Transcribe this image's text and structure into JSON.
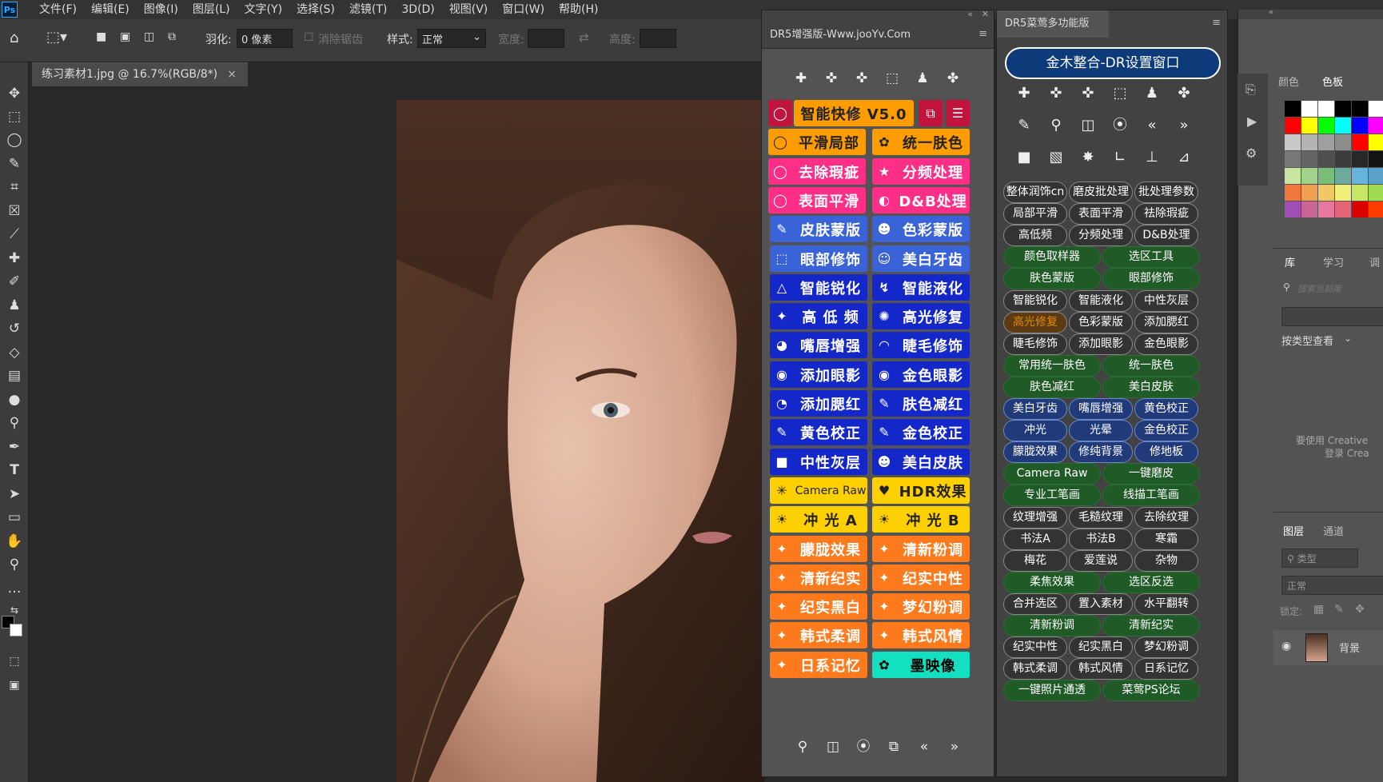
{
  "menubar": {
    "logo": "Ps",
    "items": [
      "文件(F)",
      "编辑(E)",
      "图像(I)",
      "图层(L)",
      "文字(Y)",
      "选择(S)",
      "滤镜(T)",
      "3D(D)",
      "视图(V)",
      "窗口(W)",
      "帮助(H)"
    ]
  },
  "options": {
    "feather_label": "羽化:",
    "feather_value": "0 像素",
    "antialias_label": "消除锯齿",
    "style_label": "样式:",
    "style_value": "正常",
    "width_label": "宽度:",
    "height_label": "高度:"
  },
  "doc_tab": {
    "title": "练习素材1.jpg @ 16.7%(RGB/8*)",
    "close": "×"
  },
  "panel1": {
    "title": "DR5增强版-Www.jooYv.Com",
    "buttons": [
      {
        "left": {
          "icon": "◯",
          "label": "智能快修 V5.0",
          "color": "#ff9d00",
          "text": "#222"
        }
      },
      {
        "left": {
          "icon": "◯",
          "label": "平滑局部",
          "color": "#ff9d00",
          "text": "#222"
        },
        "right": {
          "icon": "✿",
          "label": "统一肤色",
          "color": "#ff9d00",
          "text": "#222"
        }
      },
      {
        "left": {
          "icon": "◯",
          "label": "去除瑕疵",
          "color": "#ff2e87",
          "text": "#fff"
        },
        "right": {
          "icon": "★",
          "label": "分频处理",
          "color": "#ff2e87",
          "text": "#fff"
        }
      },
      {
        "left": {
          "icon": "◯",
          "label": "表面平滑",
          "color": "#ff2e87",
          "text": "#fff"
        },
        "right": {
          "icon": "◐",
          "label": "D&B处理",
          "color": "#ff2e87",
          "text": "#fff"
        }
      },
      {
        "left": {
          "icon": "✎",
          "label": "皮肤蒙版",
          "color": "#3b63d8",
          "text": "#fff"
        },
        "right": {
          "icon": "☻",
          "label": "色彩蒙版",
          "color": "#3b63d8",
          "text": "#fff"
        }
      },
      {
        "left": {
          "icon": "⬚",
          "label": "眼部修饰",
          "color": "#3b63d8",
          "text": "#fff"
        },
        "right": {
          "icon": "☺",
          "label": "美白牙齿",
          "color": "#3b63d8",
          "text": "#fff"
        }
      },
      {
        "left": {
          "icon": "△",
          "label": "智能锐化",
          "color": "#1427c9",
          "text": "#fff"
        },
        "right": {
          "icon": "↯",
          "label": "智能液化",
          "color": "#1427c9",
          "text": "#fff"
        }
      },
      {
        "left": {
          "icon": "✦",
          "label": "高 低 频",
          "color": "#1427c9",
          "text": "#fff"
        },
        "right": {
          "icon": "✺",
          "label": "高光修复",
          "color": "#1427c9",
          "text": "#fff"
        }
      },
      {
        "left": {
          "icon": "◕",
          "label": "嘴唇增强",
          "color": "#1427c9",
          "text": "#fff"
        },
        "right": {
          "icon": "◠",
          "label": "睫毛修饰",
          "color": "#1427c9",
          "text": "#fff"
        }
      },
      {
        "left": {
          "icon": "◉",
          "label": "添加眼影",
          "color": "#1427c9",
          "text": "#fff"
        },
        "right": {
          "icon": "◉",
          "label": "金色眼影",
          "color": "#1427c9",
          "text": "#fff"
        }
      },
      {
        "left": {
          "icon": "◔",
          "label": "添加腮红",
          "color": "#1427c9",
          "text": "#fff"
        },
        "right": {
          "icon": "✎",
          "label": "肤色减红",
          "color": "#1427c9",
          "text": "#fff"
        }
      },
      {
        "left": {
          "icon": "✎",
          "label": "黄色校正",
          "color": "#1427c9",
          "text": "#fff"
        },
        "right": {
          "icon": "✎",
          "label": "金色校正",
          "color": "#1427c9",
          "text": "#fff"
        }
      },
      {
        "left": {
          "icon": "■",
          "label": "中性灰层",
          "color": "#1427c9",
          "text": "#fff"
        },
        "right": {
          "icon": "☻",
          "label": "美白皮肤",
          "color": "#1427c9",
          "text": "#fff"
        }
      },
      {
        "left": {
          "icon": "✳",
          "label": "Camera Raw",
          "color": "#ffd000",
          "text": "#222"
        },
        "right": {
          "icon": "♥",
          "label": "HDR效果",
          "color": "#ffd000",
          "text": "#222"
        }
      },
      {
        "left": {
          "icon": "☀",
          "label": "冲 光 A",
          "color": "#ffd000",
          "text": "#222"
        },
        "right": {
          "icon": "☀",
          "label": "冲 光 B",
          "color": "#ffd000",
          "text": "#222"
        }
      },
      {
        "left": {
          "icon": "✦",
          "label": "朦胧效果",
          "color": "#ff7a1c",
          "text": "#fff"
        },
        "right": {
          "icon": "✦",
          "label": "清新粉调",
          "color": "#ff7a1c",
          "text": "#fff"
        }
      },
      {
        "left": {
          "icon": "✦",
          "label": "清新纪实",
          "color": "#ff7a1c",
          "text": "#fff"
        },
        "right": {
          "icon": "✦",
          "label": "纪实中性",
          "color": "#ff7a1c",
          "text": "#fff"
        }
      },
      {
        "left": {
          "icon": "✦",
          "label": "纪实黑白",
          "color": "#ff7a1c",
          "text": "#fff"
        },
        "right": {
          "icon": "✦",
          "label": "梦幻粉调",
          "color": "#ff7a1c",
          "text": "#fff"
        }
      },
      {
        "left": {
          "icon": "✦",
          "label": "韩式柔调",
          "color": "#ff7a1c",
          "text": "#fff"
        },
        "right": {
          "icon": "✦",
          "label": "韩式风情",
          "color": "#ff7a1c",
          "text": "#fff"
        }
      },
      {
        "left": {
          "icon": "✦",
          "label": "日系记忆",
          "color": "#ff7a1c",
          "text": "#fff"
        },
        "right": {
          "icon": "✿",
          "label": "墨映像",
          "color": "#12e0c0",
          "text": "#000"
        }
      }
    ]
  },
  "panel2": {
    "title": "DR5菜莺多功能版",
    "top_button": "金木整合-DR设置窗口",
    "pills": [
      [
        "整体润饰cn",
        "磨皮批处理",
        "批处理参数"
      ],
      [
        "局部平滑",
        "表面平滑",
        "祛除瑕疵"
      ],
      [
        "高低频",
        "分频处理",
        "D&B处理"
      ],
      [
        "颜色取样器",
        "选区工具"
      ],
      [
        "肤色蒙版",
        "眼部修饰"
      ],
      [
        "智能锐化",
        "智能液化",
        "中性灰层"
      ],
      [
        "高光修复",
        "色彩蒙版",
        "添加腮红"
      ],
      [
        "睫毛修饰",
        "添加眼影",
        "金色眼影"
      ],
      [
        "常用统一肤色",
        "统一肤色"
      ],
      [
        "肤色减红",
        "美白皮肤"
      ],
      [
        "美白牙齿",
        "嘴唇增强",
        "黄色校正"
      ],
      [
        "冲光",
        "光晕",
        "金色校正"
      ],
      [
        "朦胧效果",
        "修纯背景",
        "修地板"
      ],
      [
        "Camera Raw",
        "一键磨皮"
      ],
      [
        "专业工笔画",
        "线描工笔画"
      ],
      [
        "纹理增强",
        "毛糙纹理",
        "去除纹理"
      ],
      [
        "书法A",
        "书法B",
        "寒霜"
      ],
      [
        "梅花",
        "爱莲说",
        "杂物"
      ],
      [
        "柔焦效果",
        "选区反选"
      ],
      [
        "合并选区",
        "置入素材",
        "水平翻转"
      ],
      [
        "清新粉调",
        "清新纪实"
      ],
      [
        "纪实中性",
        "纪实黑白",
        "梦幻粉调"
      ],
      [
        "韩式柔调",
        "韩式风情",
        "日系记忆"
      ],
      [
        "一键照片通透",
        "菜莺PS论坛"
      ]
    ]
  },
  "right": {
    "tabs1": [
      "颜色",
      "色板"
    ],
    "tabs2": [
      "库",
      "学习",
      "调"
    ],
    "search_placeholder": "搜索当前库",
    "view_by": "按类型查看",
    "creative_msg": "要使用 Creative",
    "login_msg": "登录 Crea",
    "tabs3": [
      "图层",
      "通道"
    ],
    "kind": "类型",
    "blend": "正常",
    "lock": "锁定:",
    "layer_name": "背景"
  }
}
